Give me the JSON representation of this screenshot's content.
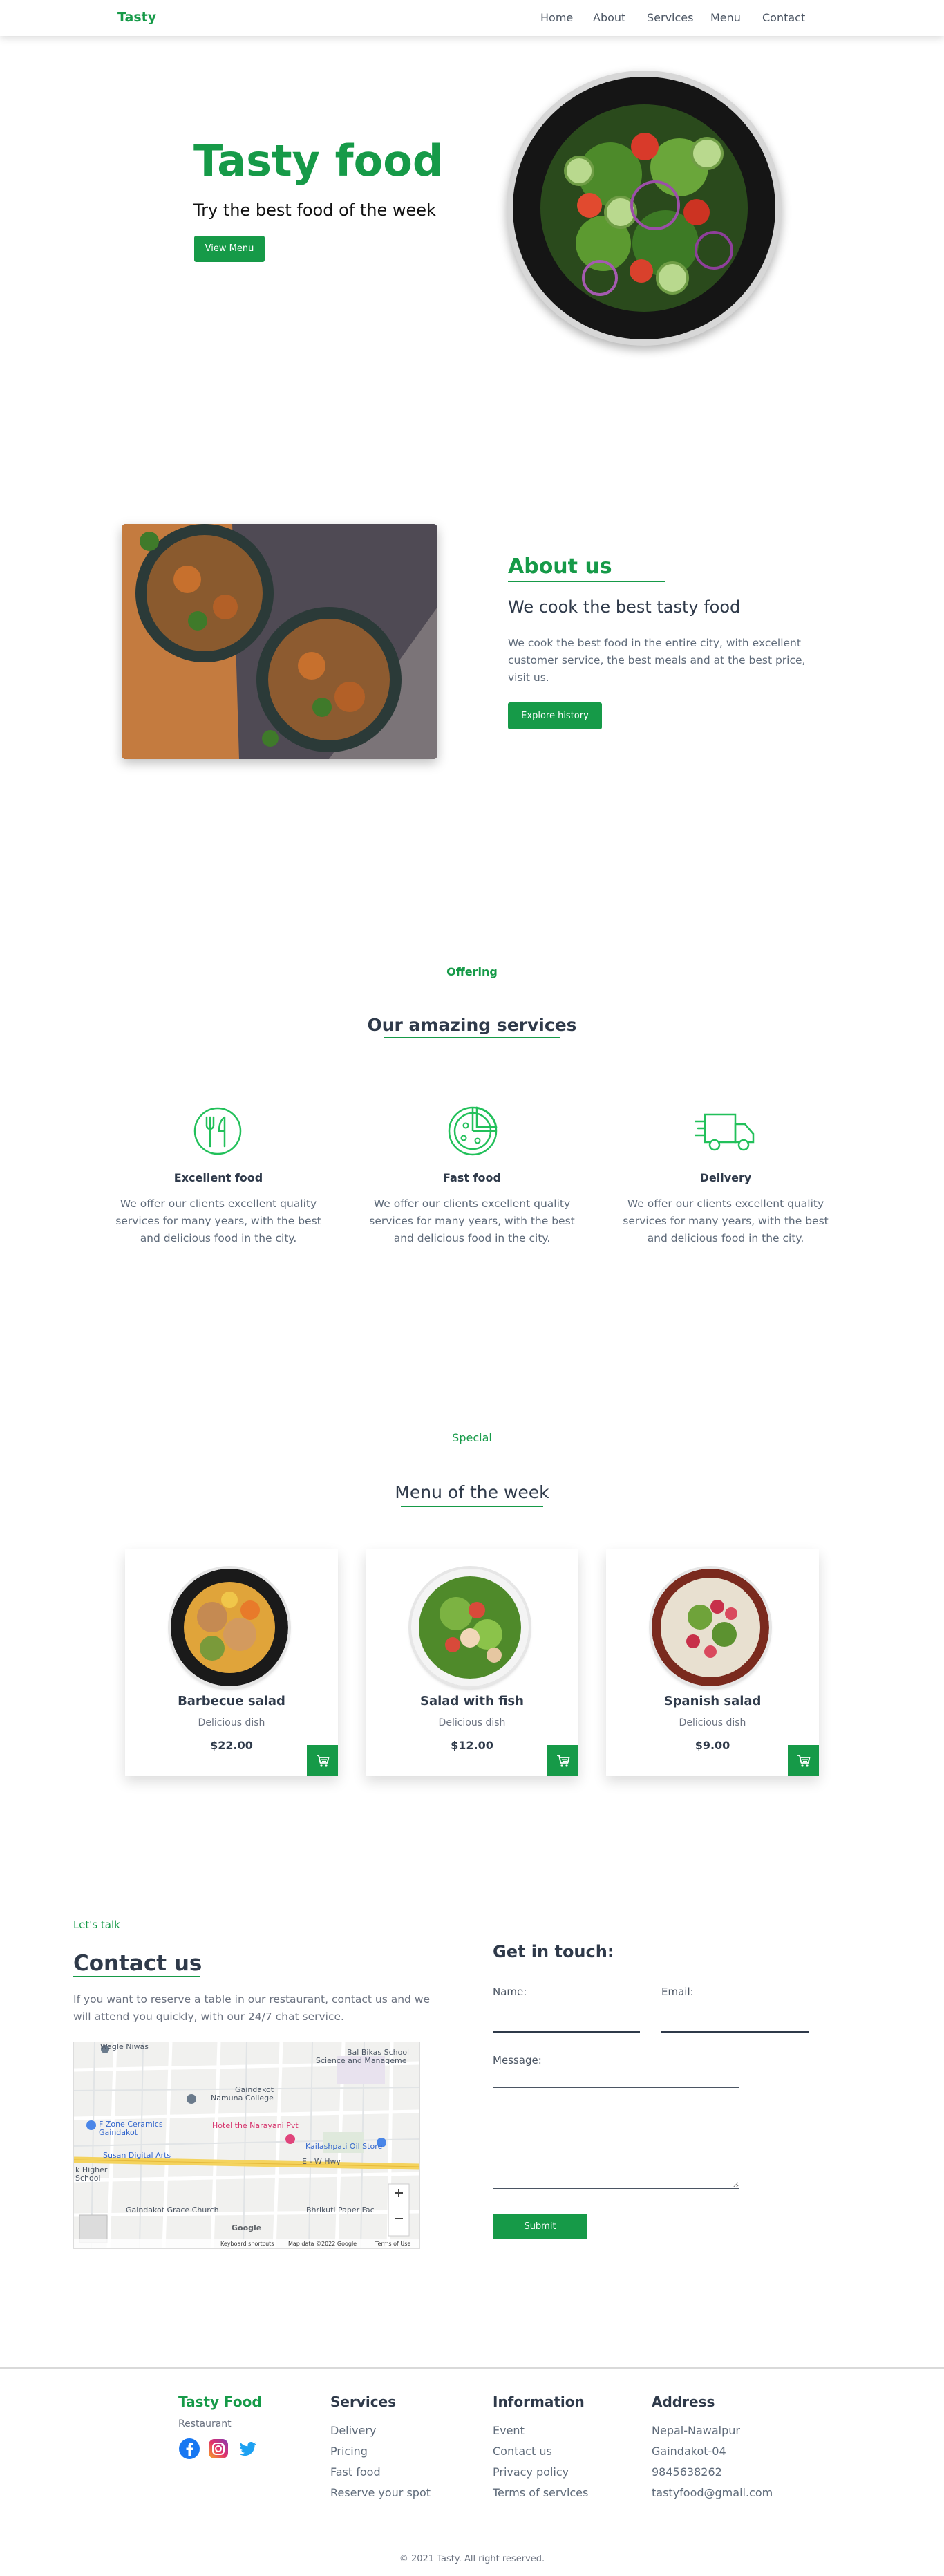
{
  "header": {
    "logo": "Tasty",
    "nav": [
      "Home",
      "About",
      "Services",
      "Menu",
      "Contact"
    ]
  },
  "hero": {
    "title": "Tasty food",
    "subtitle": "Try the best food of the week",
    "button": "View Menu"
  },
  "about": {
    "title": "About us",
    "subtitle": "We cook the best tasty food",
    "text": "We cook the best food in the entire city, with excellent customer service, the best meals and at the best price, visit us.",
    "button": "Explore history"
  },
  "services": {
    "tag": "Offering",
    "title": "Our amazing services",
    "items": [
      {
        "icon": "fork-knife-icon",
        "title": "Excellent food",
        "text": "We offer our clients excellent quality services for many years, with the best and delicious food in the city."
      },
      {
        "icon": "pizza-icon",
        "title": "Fast food",
        "text": "We offer our clients excellent quality services for many years, with the best and delicious food in the city."
      },
      {
        "icon": "delivery-truck-icon",
        "title": "Delivery",
        "text": "We offer our clients excellent quality services for many years, with the best and delicious food in the city."
      }
    ]
  },
  "menu": {
    "tag": "Special",
    "title": "Menu of the week",
    "items": [
      {
        "name": "Barbecue salad",
        "sub": "Delicious dish",
        "price": "$22.00"
      },
      {
        "name": "Salad with fish",
        "sub": "Delicious dish",
        "price": "$12.00"
      },
      {
        "name": "Spanish salad",
        "sub": "Delicious dish",
        "price": "$9.00"
      }
    ]
  },
  "contact": {
    "tag": "Let's talk",
    "title": "Contact us",
    "text": "If you want to reserve a table in our restaurant, contact us and we will attend you quickly, with our 24/7 chat service.",
    "form_title": "Get in touch:",
    "name_label": "Name:",
    "email_label": "Email:",
    "message_label": "Message:",
    "submit": "Submit",
    "map": {
      "labels": [
        "Wagle Niwas",
        "Bal Bikas School",
        "Science and Manageme",
        "Gaindakot",
        "Namuna College",
        "F Zone Ceramics",
        "Gaindakot",
        "Hotel the Narayani Pvt",
        "Kailashpati Oil Store",
        "Susan Digital Arts",
        "E - W Hwy",
        "k Higher",
        "School",
        "Gaindakot Grace Church",
        "Bhrikuti Paper Fac"
      ],
      "footer": [
        "Keyboard shortcuts",
        "Map data ©2022 Google",
        "Terms of Use"
      ],
      "brand": "Google"
    }
  },
  "footer": {
    "brand": "Tasty Food",
    "brand_sub": "Restaurant",
    "columns": [
      {
        "title": "Services",
        "items": [
          "Delivery",
          "Pricing",
          "Fast food",
          "Reserve your spot"
        ]
      },
      {
        "title": "Information",
        "items": [
          "Event",
          "Contact us",
          "Privacy policy",
          "Terms of services"
        ]
      },
      {
        "title": "Address",
        "items": [
          "Nepal-Nawalpur",
          "Gaindakot-04",
          "9845638262",
          "tastyfood@gmail.com"
        ]
      }
    ],
    "copyright": "© 2021 Tasty. All right reserved."
  },
  "colors": {
    "green": "#169a48",
    "text": "#2f3a4a"
  }
}
